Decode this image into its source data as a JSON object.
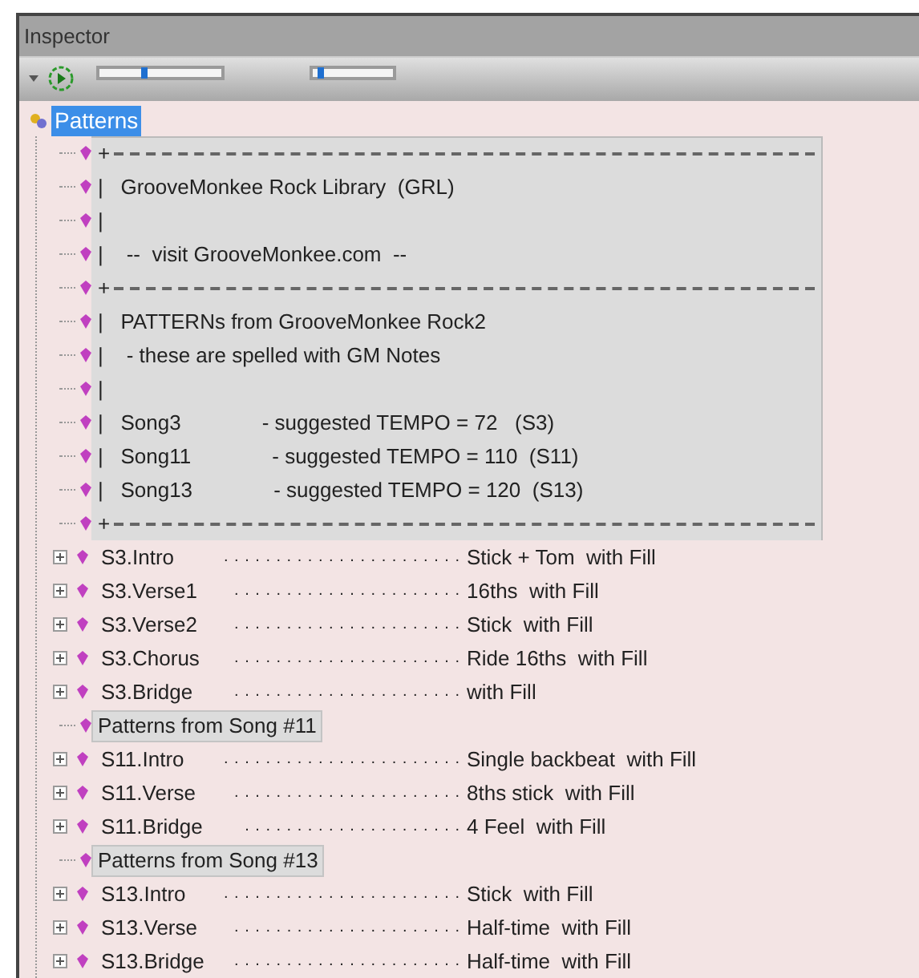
{
  "window": {
    "title": "Inspector"
  },
  "toolbar": {
    "sliders": [
      {
        "level": 0.37
      },
      {
        "level": 0.1
      }
    ]
  },
  "tree": {
    "label": "Patterns",
    "selected": true,
    "children": [
      {
        "kind": "rule",
        "text": "+"
      },
      {
        "kind": "comment",
        "text": "|   GrooveMonkee Rock Library  (GRL)"
      },
      {
        "kind": "comment",
        "text": "|"
      },
      {
        "kind": "comment",
        "text": "|    --  visit GrooveMonkee.com  --"
      },
      {
        "kind": "rule",
        "text": "+"
      },
      {
        "kind": "comment",
        "text": "|   PATTERNs from GrooveMonkee Rock2"
      },
      {
        "kind": "comment",
        "text": "|    - these are spelled with GM Notes"
      },
      {
        "kind": "comment",
        "text": "|"
      },
      {
        "kind": "comment",
        "text": "|   Song3              - suggested TEMPO = 72   (S3)"
      },
      {
        "kind": "comment",
        "text": "|   Song11              - suggested TEMPO = 110  (S11)"
      },
      {
        "kind": "comment",
        "text": "|   Song13              - suggested TEMPO = 120  (S13)"
      },
      {
        "kind": "rule",
        "text": "+"
      },
      {
        "kind": "pattern",
        "expanded": false,
        "name": "S3.Intro",
        "leader": ". . . . . . . . . . . . . . . . . . . . . . .",
        "description": "Stick + Tom  with Fill"
      },
      {
        "kind": "pattern",
        "expanded": false,
        "name": "S3.Verse1",
        "leader": ". . . . . . . . . . . . . . . . . . . . . .",
        "description": "16ths  with Fill"
      },
      {
        "kind": "pattern",
        "expanded": false,
        "name": "S3.Verse2",
        "leader": ". . . . . . . . . . . . . . . . . . . . . .",
        "description": "Stick  with Fill"
      },
      {
        "kind": "pattern",
        "expanded": false,
        "name": "S3.Chorus",
        "leader": ". . . . . . . . . . . . . . . . . . . . . .",
        "description": "Ride 16ths  with Fill"
      },
      {
        "kind": "pattern",
        "expanded": false,
        "name": "S3.Bridge",
        "leader": ". . . . . . . . . . . . . . . . . . . . . .",
        "description": "with Fill"
      },
      {
        "kind": "group",
        "text": "Patterns from Song #11"
      },
      {
        "kind": "pattern",
        "expanded": false,
        "name": "S11.Intro",
        "leader": ". . . . . . . . . . . . . . . . . . . . . . .",
        "description": "Single backbeat  with Fill"
      },
      {
        "kind": "pattern",
        "expanded": false,
        "name": "S11.Verse",
        "leader": ". . . . . . . . . . . . . . . . . . . . . .",
        "description": "8ths stick  with Fill"
      },
      {
        "kind": "pattern",
        "expanded": false,
        "name": "S11.Bridge",
        "leader": ". . . . . . . . . . . . . . . . . . . . .",
        "description": "4 Feel  with Fill"
      },
      {
        "kind": "group",
        "text": "Patterns from Song #13"
      },
      {
        "kind": "pattern",
        "expanded": false,
        "name": "S13.Intro",
        "leader": ". . . . . . . . . . . . . . . . . . . . . . .",
        "description": "Stick  with Fill"
      },
      {
        "kind": "pattern",
        "expanded": false,
        "name": "S13.Verse",
        "leader": ". . . . . . . . . . . . . . . . . . . . . .",
        "description": "Half-time  with Fill"
      },
      {
        "kind": "pattern",
        "expanded": false,
        "name": "S13.Bridge",
        "leader": ". . . . . . . . . . . . . . . . . . . . . .",
        "description": "Half-time  with Fill"
      }
    ]
  }
}
